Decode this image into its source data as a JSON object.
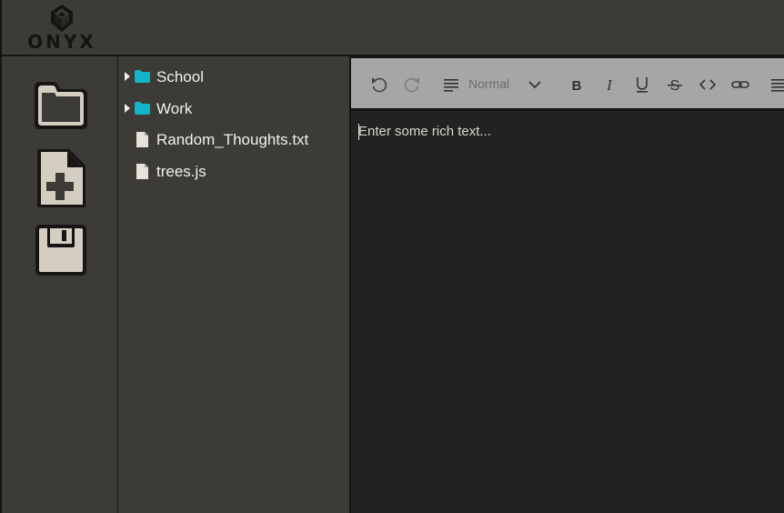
{
  "app": {
    "logo_text": "ONYX"
  },
  "sidebar": {
    "buttons": [
      {
        "name": "open-folder",
        "icon": "folder-icon"
      },
      {
        "name": "new-file",
        "icon": "file-plus-icon"
      },
      {
        "name": "save",
        "icon": "floppy-disk-icon"
      }
    ]
  },
  "filetree": {
    "items": [
      {
        "type": "folder",
        "label": "School",
        "expanded": false,
        "icon": "folder-icon"
      },
      {
        "type": "folder",
        "label": "Work",
        "expanded": false,
        "icon": "folder-icon"
      },
      {
        "type": "file",
        "label": "Random_Thoughts.txt",
        "icon": "file-icon"
      },
      {
        "type": "file",
        "label": "trees.js",
        "icon": "file-icon"
      }
    ]
  },
  "toolbar": {
    "block_type": "Normal",
    "buttons": [
      "undo",
      "redo",
      "bold",
      "italic",
      "underline",
      "strikethrough",
      "code",
      "link",
      "align"
    ]
  },
  "editor": {
    "placeholder": "Enter some rich text..."
  },
  "colors": {
    "panel": "#3d3b36",
    "editor_bg": "#232220",
    "toolbar_bg": "#a6a6a4",
    "folder_accent": "#11b4c8",
    "icon_fill": "#d4cdc1"
  }
}
